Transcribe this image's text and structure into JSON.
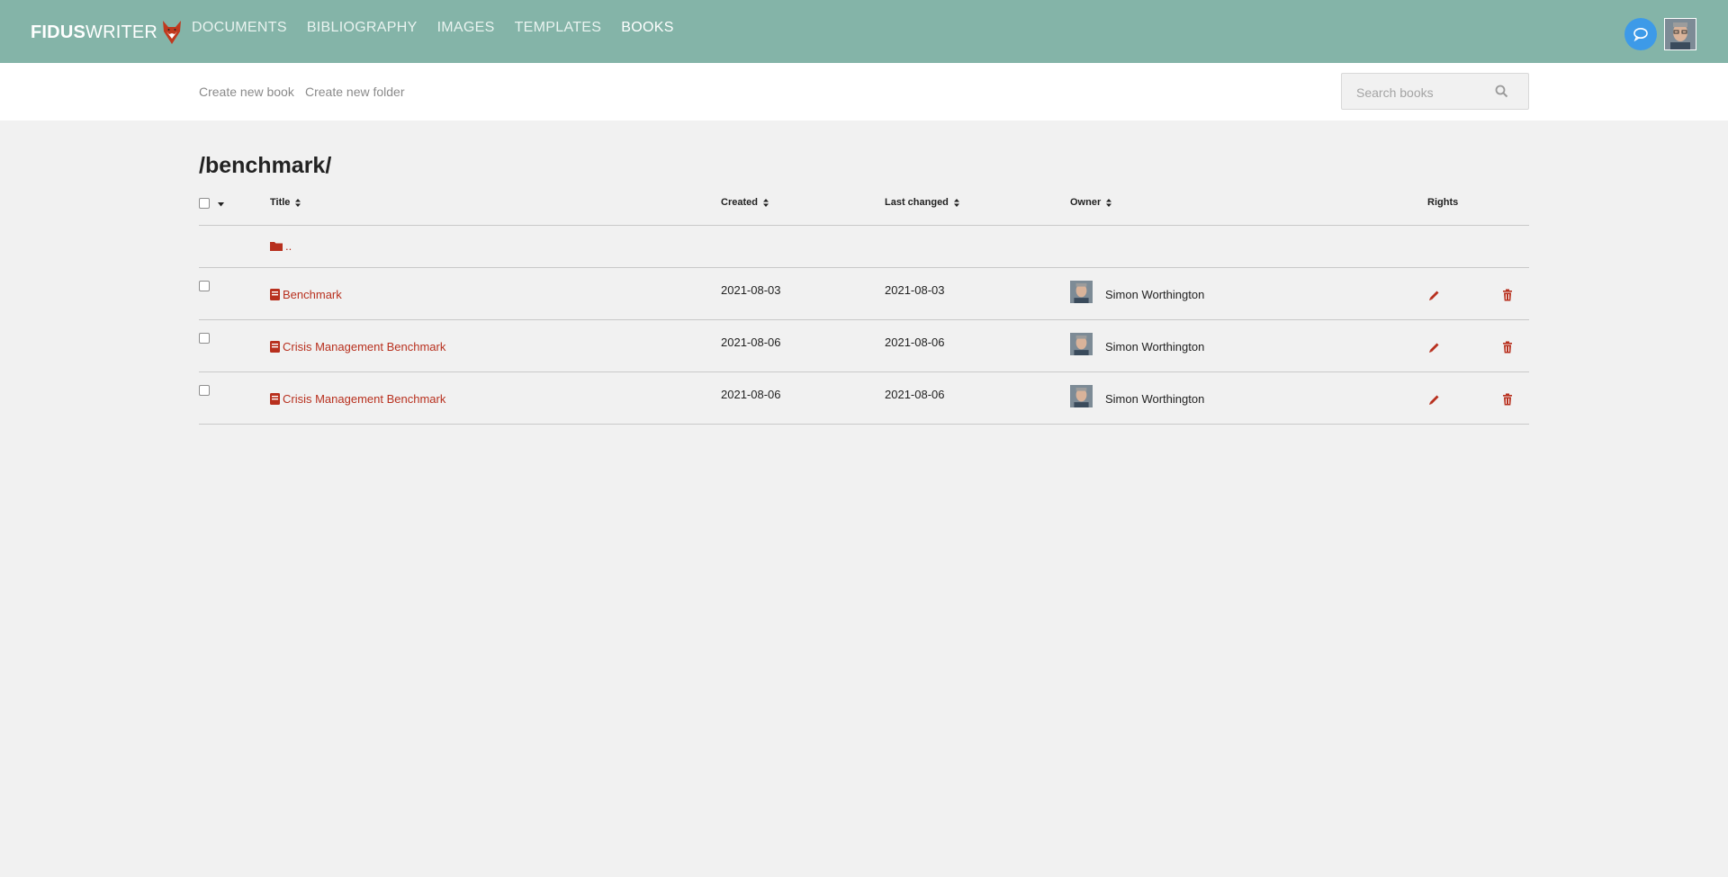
{
  "app": {
    "logo_bold": "FIDUS",
    "logo_light": "WRITER"
  },
  "nav": [
    {
      "label": "DOCUMENTS",
      "active": false
    },
    {
      "label": "BIBLIOGRAPHY",
      "active": false
    },
    {
      "label": "IMAGES",
      "active": false
    },
    {
      "label": "TEMPLATES",
      "active": false
    },
    {
      "label": "BOOKS",
      "active": true
    }
  ],
  "toolbar": {
    "create_book": "Create new book",
    "create_folder": "Create new folder",
    "search_placeholder": "Search books"
  },
  "path": "/benchmark/",
  "columns": {
    "title": "Title",
    "created": "Created",
    "last_changed": "Last changed",
    "owner": "Owner",
    "rights": "Rights"
  },
  "parent_folder": "..",
  "books": [
    {
      "title": "Benchmark",
      "created": "2021-08-03",
      "last_changed": "2021-08-03",
      "owner": "Simon Worthington"
    },
    {
      "title": "Crisis Management Benchmark",
      "created": "2021-08-06",
      "last_changed": "2021-08-06",
      "owner": "Simon Worthington"
    },
    {
      "title": "Crisis Management Benchmark",
      "created": "2021-08-06",
      "last_changed": "2021-08-06",
      "owner": "Simon Worthington"
    }
  ],
  "colors": {
    "header": "#84b4a8",
    "accent": "#b8301e",
    "chat": "#3d9ae8",
    "background": "#f1f1f1"
  },
  "icons": {
    "logo": "fox-icon",
    "chat": "chat-bubble-icon",
    "search": "search-icon",
    "sort": "sort-icon",
    "folder": "folder-icon",
    "book": "book-icon",
    "edit": "pencil-icon",
    "delete": "trash-icon"
  }
}
